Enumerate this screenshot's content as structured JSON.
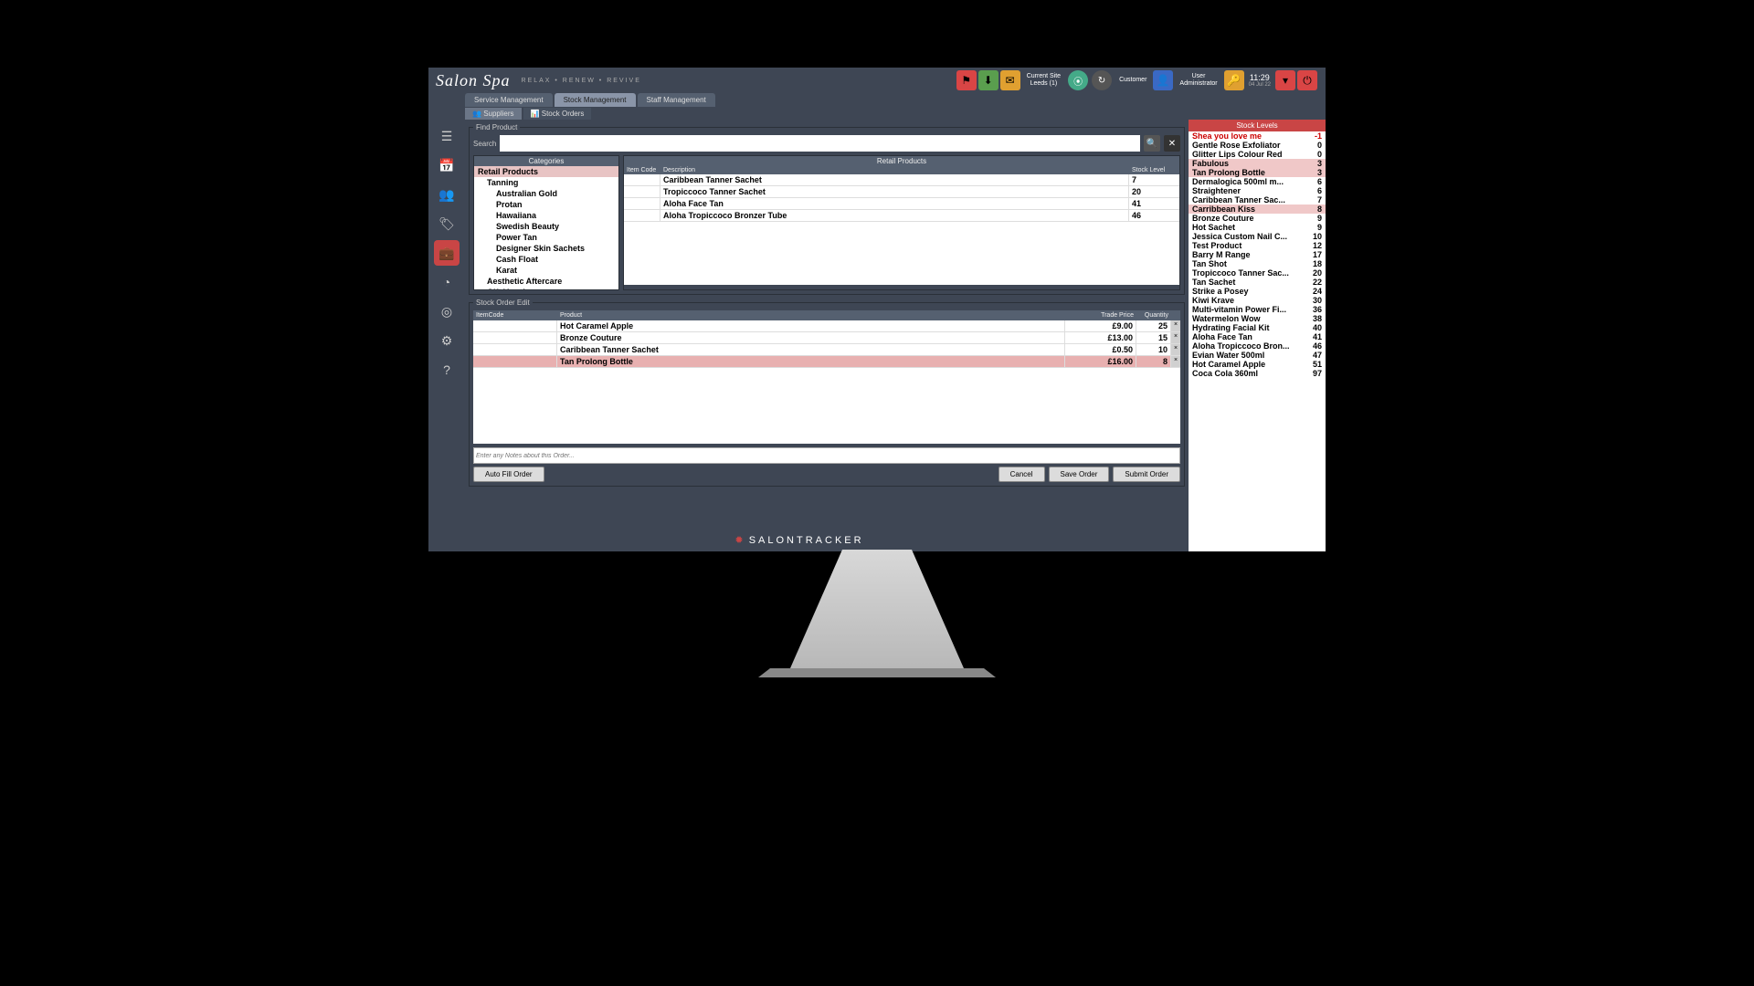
{
  "brand": {
    "name": "Salon Spa",
    "tagline": "RELAX • RENEW • REVIVE"
  },
  "header": {
    "site_label": "Current Site",
    "site_value": "Leeds (1)",
    "customer_label": "Customer",
    "user_label": "User",
    "user_value": "Administrator",
    "time": "11:29",
    "date": "04 Jul 22"
  },
  "tabs": [
    "Service Management",
    "Stock Management",
    "Staff Management"
  ],
  "active_tab": 1,
  "subtabs": [
    "Suppliers",
    "Stock Orders"
  ],
  "active_subtab": 0,
  "find": {
    "legend": "Find Product",
    "search_label": "Search",
    "search_value": "",
    "categories_header": "Categories",
    "cat_root": "Retail Products",
    "cat_sub": "Tanning",
    "cat_items": [
      "Australian Gold",
      "Protan",
      "Hawaiiana",
      "Swedish Beauty",
      "Power Tan",
      "Designer Skin Sachets",
      "Cash Float",
      "Karat"
    ],
    "cat_extra": [
      "Aesthetic Aftercare",
      "Gift Vouchers"
    ],
    "retail_header": "Retail Products",
    "retail_cols": [
      "Item Code",
      "Description",
      "Stock Level"
    ],
    "retail_rows": [
      {
        "code": "",
        "desc": "Caribbean Tanner Sachet",
        "stock": "7"
      },
      {
        "code": "",
        "desc": "Tropiccoco Tanner Sachet",
        "stock": "20"
      },
      {
        "code": "",
        "desc": "Aloha Face Tan",
        "stock": "41"
      },
      {
        "code": "",
        "desc": "Aloha Tropiccoco Bronzer Tube",
        "stock": "46"
      }
    ]
  },
  "order": {
    "legend": "Stock Order Edit",
    "cols": [
      "ItemCode",
      "Product",
      "Trade Price",
      "Quantity"
    ],
    "rows": [
      {
        "code": "",
        "product": "Hot Caramel Apple",
        "price": "£9.00",
        "qty": "25"
      },
      {
        "code": "",
        "product": "Bronze Couture",
        "price": "£13.00",
        "qty": "15"
      },
      {
        "code": "",
        "product": "Caribbean Tanner Sachet",
        "price": "£0.50",
        "qty": "10"
      },
      {
        "code": "",
        "product": "Tan Prolong Bottle",
        "price": "£16.00",
        "qty": "8"
      }
    ],
    "selected": 3,
    "notes_placeholder": "Enter any Notes about this Order...",
    "btn_autofill": "Auto Fill Order",
    "btn_cancel": "Cancel",
    "btn_save": "Save Order",
    "btn_submit": "Submit Order"
  },
  "stock": {
    "header": "Stock Levels",
    "rows": [
      {
        "n": "Shea you love me",
        "v": "-1",
        "neg": true
      },
      {
        "n": "Gentle Rose Exfoliator",
        "v": "0"
      },
      {
        "n": "Glitter Lips Colour Red",
        "v": "0"
      },
      {
        "n": "Fabulous",
        "v": "3",
        "low": true
      },
      {
        "n": "Tan Prolong Bottle",
        "v": "3",
        "low": true
      },
      {
        "n": "Dermalogica 500ml m...",
        "v": "6"
      },
      {
        "n": "Straightener",
        "v": "6"
      },
      {
        "n": "Caribbean Tanner Sac...",
        "v": "7"
      },
      {
        "n": "Carribbean Kiss",
        "v": "8",
        "low": true
      },
      {
        "n": "Bronze Couture",
        "v": "9"
      },
      {
        "n": "Hot Sachet",
        "v": "9"
      },
      {
        "n": "Jessica Custom Nail C...",
        "v": "10"
      },
      {
        "n": "Test Product",
        "v": "12"
      },
      {
        "n": "Barry M Range",
        "v": "17"
      },
      {
        "n": "Tan Shot",
        "v": "18"
      },
      {
        "n": "Tropiccoco Tanner Sac...",
        "v": "20"
      },
      {
        "n": "Tan Sachet",
        "v": "22"
      },
      {
        "n": "Strike a Posey",
        "v": "24"
      },
      {
        "n": "Kiwi Krave",
        "v": "30"
      },
      {
        "n": "Multi-vitamin Power Fi...",
        "v": "36"
      },
      {
        "n": "Watermelon Wow",
        "v": "38"
      },
      {
        "n": "Hydrating Facial Kit",
        "v": "40"
      },
      {
        "n": "Aloha Face Tan",
        "v": "41"
      },
      {
        "n": "Aloha Tropiccoco Bron...",
        "v": "46"
      },
      {
        "n": "Evian Water 500ml",
        "v": "47"
      },
      {
        "n": "Hot Caramel Apple",
        "v": "51"
      },
      {
        "n": "Coca Cola 360ml",
        "v": "97"
      }
    ]
  },
  "footer": "SALONTRACKER"
}
